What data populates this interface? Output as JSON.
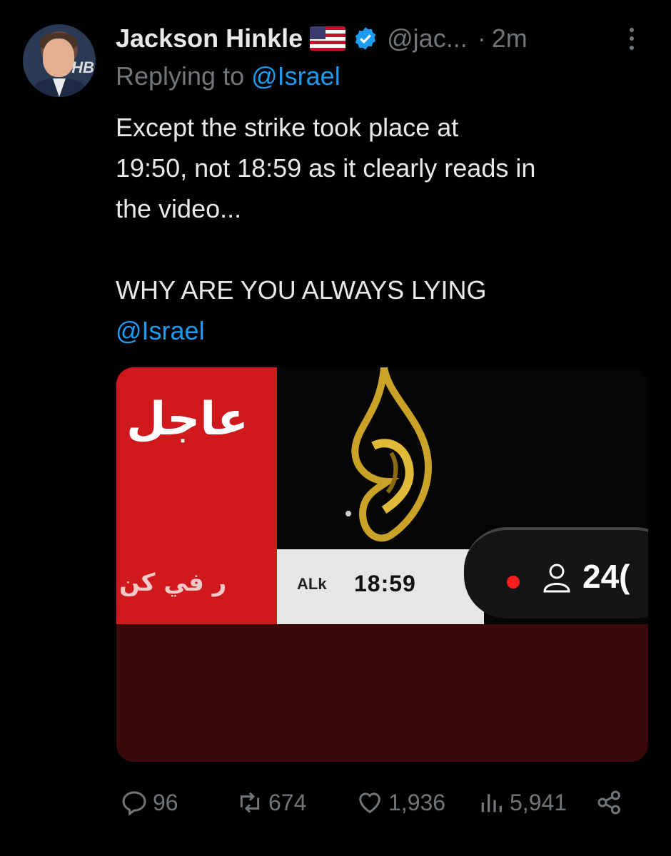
{
  "tweet": {
    "author_name": "Jackson Hinkle",
    "flag": "us-flag-icon",
    "verified": "verified-badge-icon",
    "handle": "@jac...",
    "separator": "·",
    "time": "2m",
    "replying_prefix": "Replying to",
    "replying_to": "@Israel",
    "text_line1": "Except the strike took place at",
    "text_line2": "19:50, not 18:59 as it clearly reads in",
    "text_line3": "the video...",
    "text_line4": "WHY ARE YOU ALWAYS LYING",
    "mention": "@Israel",
    "avatar_text": "HB"
  },
  "media": {
    "arabic_breaking": "عاجل",
    "arabic_ticker": "ر في كن",
    "ticker_small": "ALk",
    "clock": "18:59",
    "viewers": "24(",
    "colors": {
      "red": "#d0191c",
      "dark": "#3a090b",
      "gold": "#c9a227"
    }
  },
  "actions": {
    "replies": "96",
    "reposts": "674",
    "likes": "1,936",
    "views": "5,941"
  },
  "colors": {
    "accent": "#1d9bf0",
    "muted": "#71767b",
    "text": "#e7e9ea",
    "background": "#000000"
  }
}
